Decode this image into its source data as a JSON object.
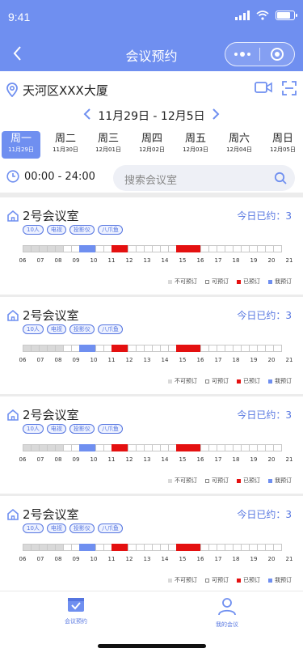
{
  "status": {
    "time": "9:41",
    "battery_level": 0.85
  },
  "nav": {
    "title": "会议预约",
    "back_icon": "chevron-left-icon"
  },
  "location": {
    "text": "天河区XXX大厦"
  },
  "date_range": {
    "label": "11月29日 - 12月5日"
  },
  "week": {
    "days": [
      {
        "weekday": "周一",
        "date": "11月29日",
        "active": true
      },
      {
        "weekday": "周二",
        "date": "11月30日",
        "active": false
      },
      {
        "weekday": "周三",
        "date": "12月01日",
        "active": false
      },
      {
        "weekday": "周四",
        "date": "12月02日",
        "active": false
      },
      {
        "weekday": "周五",
        "date": "12月03日",
        "active": false
      },
      {
        "weekday": "周六",
        "date": "12月04日",
        "active": false
      },
      {
        "weekday": "周日",
        "date": "12月05日",
        "active": false
      }
    ]
  },
  "time_filter": {
    "range": "00:00 - 24:00"
  },
  "search": {
    "placeholder": "搜索会议室"
  },
  "rooms": [
    {
      "name": "2号会议室",
      "booked_label": "今日已约：3",
      "tags": [
        "10人",
        "电视",
        "投影仪",
        "八爪鱼"
      ]
    },
    {
      "name": "2号会议室",
      "booked_label": "今日已约：3",
      "tags": [
        "10人",
        "电视",
        "投影仪",
        "八爪鱼"
      ]
    },
    {
      "name": "2号会议室",
      "booked_label": "今日已约：3",
      "tags": [
        "10人",
        "电视",
        "投影仪",
        "八爪鱼"
      ]
    },
    {
      "name": "2号会议室",
      "booked_label": "今日已约：3",
      "tags": [
        "10人",
        "电视",
        "投影仪",
        "八爪鱼"
      ]
    }
  ],
  "timeline": {
    "hours": [
      "06",
      "07",
      "08",
      "09",
      "10",
      "11",
      "12",
      "13",
      "14",
      "15",
      "16",
      "17",
      "18",
      "19",
      "20",
      "21"
    ],
    "slot_states": [
      0,
      0,
      0,
      0,
      0,
      1,
      1,
      3,
      3,
      1,
      1,
      2,
      2,
      1,
      1,
      1,
      1,
      1,
      1,
      2,
      2,
      2,
      1,
      1,
      1,
      1,
      1,
      1,
      1,
      1,
      1,
      1
    ]
  },
  "legend": [
    {
      "label": "不可预订",
      "color": "#d9d9d9"
    },
    {
      "label": "可预订",
      "color": "#ffffff"
    },
    {
      "label": "已预订",
      "color": "#e41010"
    },
    {
      "label": "我预订",
      "color": "#6f8ff0"
    }
  ],
  "tabs": [
    {
      "label": "会议预约",
      "icon": "calendar-check-icon",
      "active": true
    },
    {
      "label": "我的会议",
      "icon": "user-icon",
      "active": false
    }
  ],
  "colors": {
    "primary": "#6f8ff0",
    "accent_text": "#5575e0",
    "booked": "#e41010",
    "unavailable": "#d9d9d9"
  }
}
